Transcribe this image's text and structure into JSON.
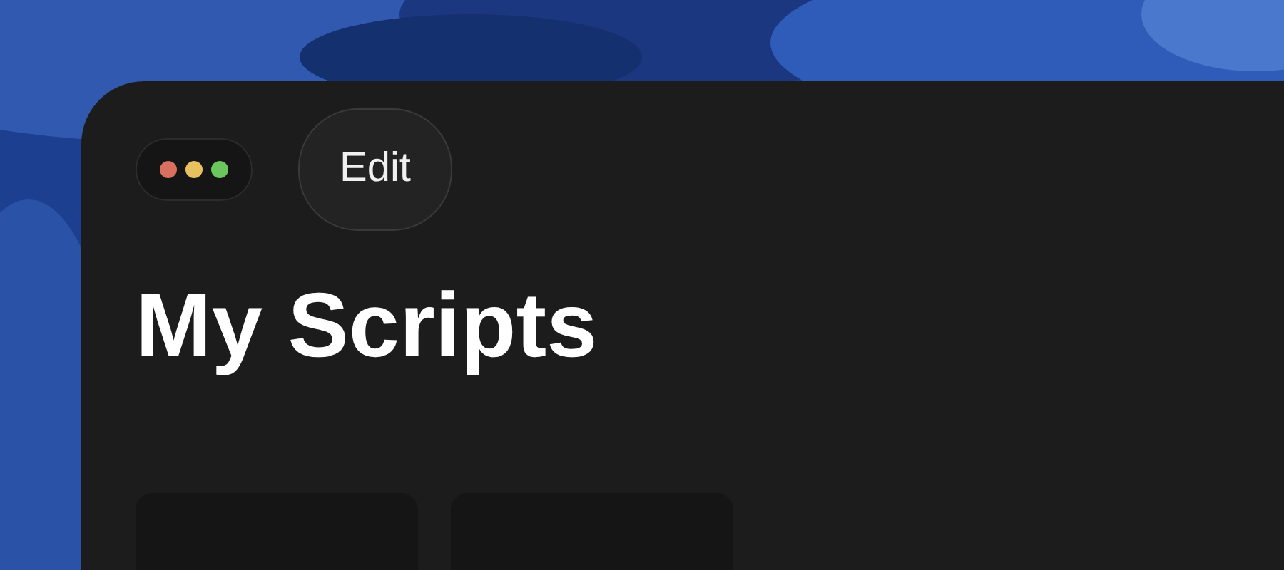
{
  "window_controls": [
    {
      "color": "#d9705f"
    },
    {
      "color": "#e9c060"
    },
    {
      "color": "#6cc65e"
    }
  ],
  "edit_button": {
    "label": "Edit"
  },
  "title": "My Scripts",
  "cards": [
    {
      "kind": "script"
    },
    {
      "kind": "script"
    }
  ]
}
